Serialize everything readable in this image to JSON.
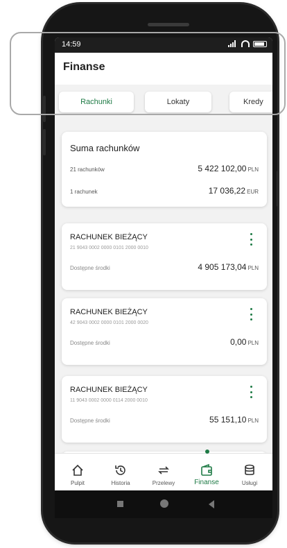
{
  "status": {
    "time": "14:59"
  },
  "header": {
    "title": "Finanse"
  },
  "tabs": [
    {
      "label": "Rachunki",
      "active": true
    },
    {
      "label": "Lokaty",
      "active": false
    },
    {
      "label": "Kredy",
      "active": false
    }
  ],
  "summary": {
    "title": "Suma rachunków",
    "rows": [
      {
        "label": "21 rachunków",
        "value": "5 422 102,00",
        "currency": "PLN"
      },
      {
        "label": "1 rachunek",
        "value": "17 036,22",
        "currency": "EUR"
      }
    ]
  },
  "accounts": [
    {
      "name": "RACHUNEK BIEŻĄCY",
      "number": "21 9043 0002 0000 0101 2000 0010",
      "available_label": "Dostępne środki",
      "balance": "4 905 173,04",
      "currency": "PLN"
    },
    {
      "name": "RACHUNEK BIEŻĄCY",
      "number": "42 9043 0002 0000 0101 2000 0020",
      "available_label": "Dostępne środki",
      "balance": "0,00",
      "currency": "PLN"
    },
    {
      "name": "RACHUNEK BIEŻĄCY",
      "number": "11 9043 0002 0000 0114 2000 0010",
      "available_label": "Dostępne środki",
      "balance": "55 151,10",
      "currency": "PLN"
    }
  ],
  "nav": [
    {
      "label": "Pulpit",
      "icon": "home-icon"
    },
    {
      "label": "Historia",
      "icon": "history-icon"
    },
    {
      "label": "Przelewy",
      "icon": "transfer-icon"
    },
    {
      "label": "Finanse",
      "icon": "wallet-icon",
      "active": true
    },
    {
      "label": "Usługi",
      "icon": "database-icon"
    }
  ],
  "colors": {
    "accent": "#1e7a45",
    "background": "#f2f2f2"
  }
}
